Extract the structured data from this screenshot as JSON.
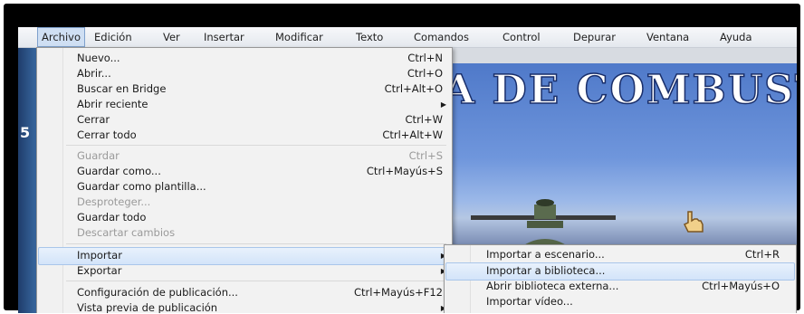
{
  "menubar": {
    "items": [
      {
        "label": "Archivo"
      },
      {
        "label": "Edición"
      },
      {
        "label": "Ver"
      },
      {
        "label": "Insertar"
      },
      {
        "label": "Modificar"
      },
      {
        "label": "Texto"
      },
      {
        "label": "Comandos"
      },
      {
        "label": "Control"
      },
      {
        "label": "Depurar"
      },
      {
        "label": "Ventana"
      },
      {
        "label": "Ayuda"
      }
    ]
  },
  "stage": {
    "title_text": "A DE COMBUST"
  },
  "left_strip": {
    "letter": "5"
  },
  "file_menu": {
    "items": [
      {
        "label": "Nuevo...",
        "shortcut": "Ctrl+N"
      },
      {
        "label": "Abrir...",
        "shortcut": "Ctrl+O"
      },
      {
        "label": "Buscar en Bridge",
        "shortcut": "Ctrl+Alt+O"
      },
      {
        "label": "Abrir reciente",
        "shortcut": ""
      },
      {
        "label": "Cerrar",
        "shortcut": "Ctrl+W"
      },
      {
        "label": "Cerrar todo",
        "shortcut": "Ctrl+Alt+W"
      },
      {
        "label": "Guardar",
        "shortcut": "Ctrl+S"
      },
      {
        "label": "Guardar como...",
        "shortcut": "Ctrl+Mayús+S"
      },
      {
        "label": "Guardar como plantilla...",
        "shortcut": ""
      },
      {
        "label": "Desproteger...",
        "shortcut": ""
      },
      {
        "label": "Guardar todo",
        "shortcut": ""
      },
      {
        "label": "Descartar cambios",
        "shortcut": ""
      },
      {
        "label": "Importar",
        "shortcut": ""
      },
      {
        "label": "Exportar",
        "shortcut": ""
      },
      {
        "label": "Configuración de publicación...",
        "shortcut": "Ctrl+Mayús+F12"
      },
      {
        "label": "Vista previa de publicación",
        "shortcut": ""
      }
    ]
  },
  "import_submenu": {
    "items": [
      {
        "label": "Importar a escenario...",
        "shortcut": "Ctrl+R"
      },
      {
        "label": "Importar a biblioteca...",
        "shortcut": ""
      },
      {
        "label": "Abrir biblioteca externa...",
        "shortcut": "Ctrl+Mayús+O"
      },
      {
        "label": "Importar vídeo...",
        "shortcut": ""
      }
    ]
  },
  "colors": {
    "highlight": "#d3e4f9",
    "menu_bg": "#f2f2f2",
    "disabled_text": "#9a9a9a"
  }
}
